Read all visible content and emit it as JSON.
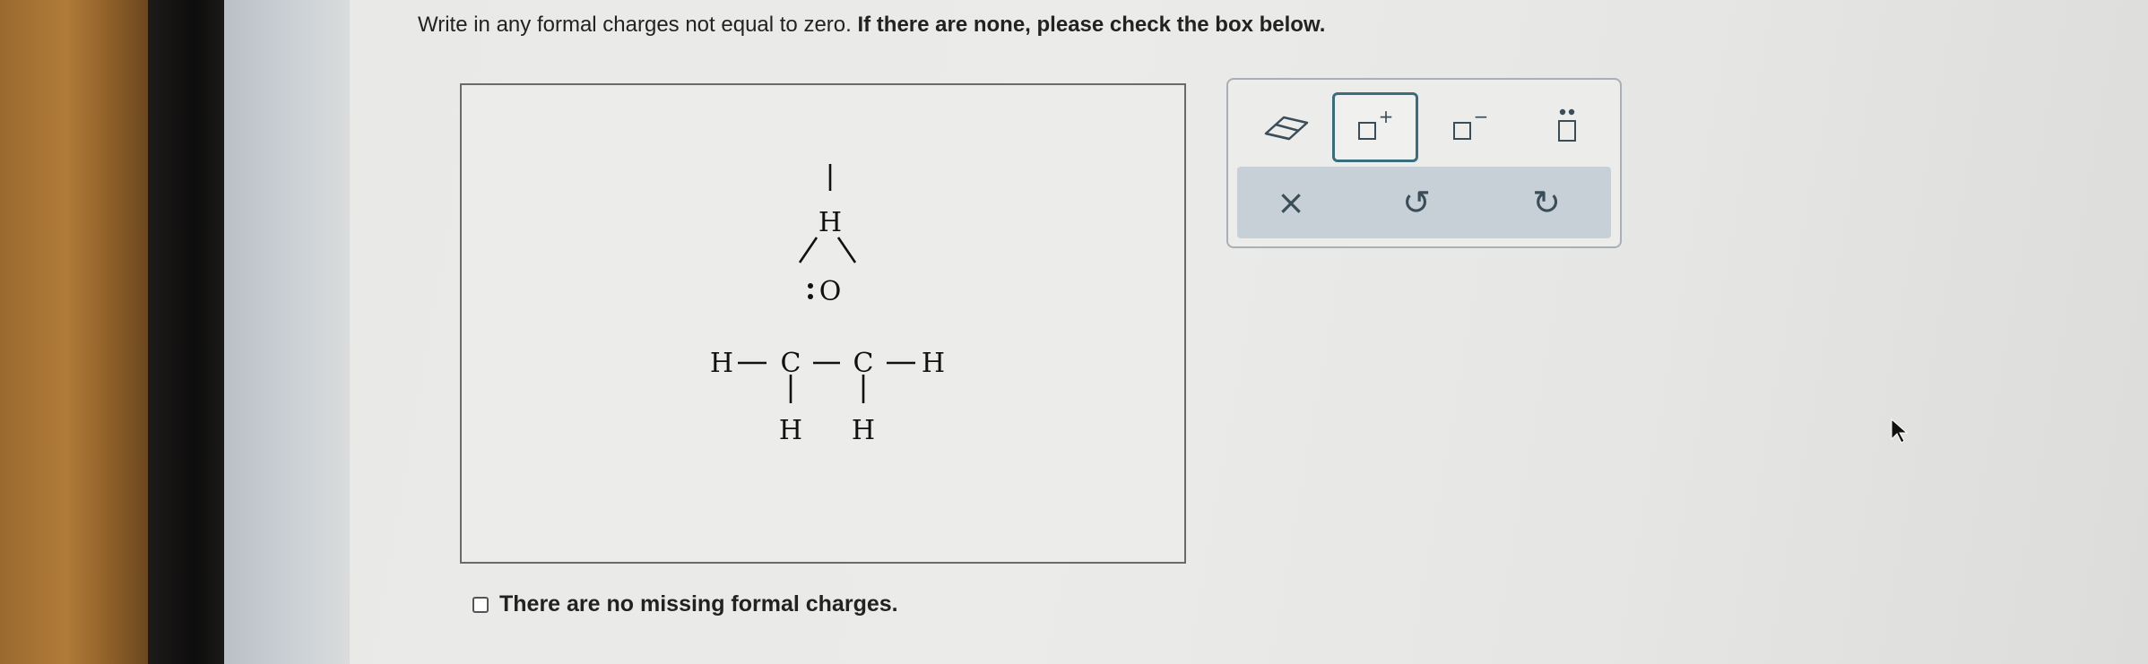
{
  "instructions": {
    "normal": "Write in any formal charges not equal to zero.",
    "bold": "If there are none, please check the box below."
  },
  "molecule": {
    "atoms": {
      "o_h": "H",
      "oxygen": "O",
      "c_left": "C",
      "c_right": "C",
      "h_left": "H",
      "h_right": "H",
      "h_bottom_left": "H",
      "h_bottom_right": "H"
    },
    "lone_pair_on": "O"
  },
  "no_charge_option": {
    "label": "There are no missing formal charges.",
    "checked": false
  },
  "toolbar": {
    "tools": [
      "eraser-icon",
      "positive-charge-icon",
      "negative-charge-icon",
      "lone-pair-icon"
    ],
    "plus_sign": "+",
    "minus_sign": "−",
    "selected_tool": "positive-charge",
    "actions": {
      "clear": "×",
      "undo": "↺",
      "redo": "↻"
    }
  },
  "colors": {
    "selected_border": "#3a6e7d",
    "action_bar": "#c7d0d6",
    "icon": "#3b4d58"
  }
}
